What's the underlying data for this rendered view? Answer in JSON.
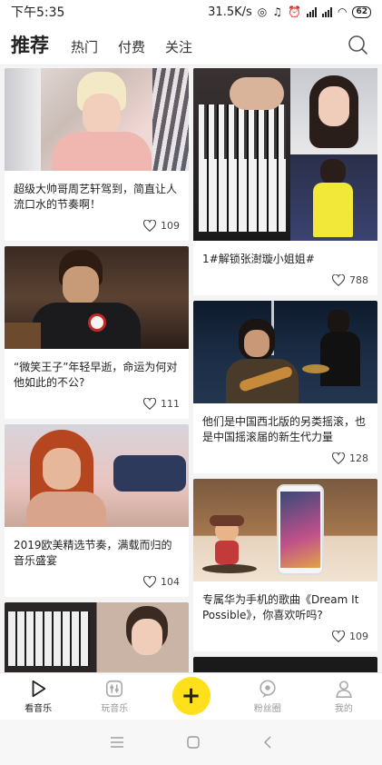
{
  "status": {
    "time": "下午5:35",
    "speed": "31.5K/s",
    "battery": "62"
  },
  "header": {
    "tabs": [
      {
        "label": "推荐"
      },
      {
        "label": "热门"
      },
      {
        "label": "付费"
      },
      {
        "label": "关注"
      }
    ]
  },
  "feed": {
    "left": [
      {
        "title": "超级大帅哥周艺轩驾到，简直让人流口水的节奏啊！",
        "likes": "109"
      },
      {
        "title": "“微笑王子”年轻早逝，命运为何对他如此的不公?",
        "likes": "111"
      },
      {
        "title": "2019欧美精选节奏，满载而归的音乐盛宴",
        "likes": "104"
      }
    ],
    "right": [
      {
        "title": "1#解锁张澍璇小姐姐#",
        "likes": "788"
      },
      {
        "title": "他们是中国西北版的另类摇滚，也是中国摇滚届的新生代力量",
        "likes": "128"
      },
      {
        "title": "专属华为手机的歌曲《Dream It Possible》，你喜欢听吗?",
        "likes": "109"
      }
    ]
  },
  "bottom_nav": {
    "items": [
      {
        "label": "看音乐"
      },
      {
        "label": "玩音乐"
      },
      {
        "label": "+"
      },
      {
        "label": "粉丝圈"
      },
      {
        "label": "我的"
      }
    ]
  },
  "colors": {
    "accent": "#ffe01b",
    "icon": "#333333",
    "muted": "#999999"
  }
}
